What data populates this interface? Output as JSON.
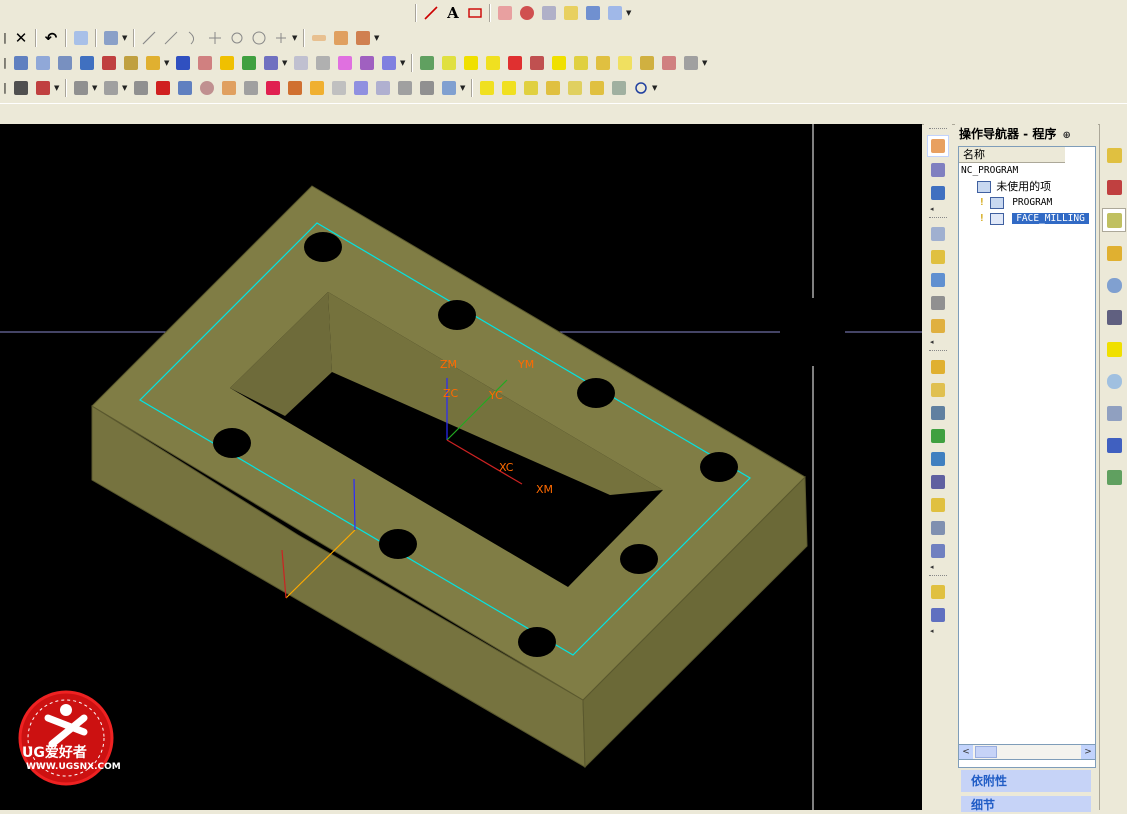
{
  "toolbar": {
    "text_tool_glyph": "A",
    "undo_glyph": "↶",
    "delete_glyph": "✕",
    "row0": [
      "line-icon",
      "text-icon",
      "rectangle-icon",
      "face-icon",
      "curve-icon",
      "transform-icon",
      "analysis-icon",
      "feature-icon",
      "view-icon"
    ],
    "row1": [
      "undo-icon",
      "copy-icon",
      "properties-icon",
      "line-icon",
      "arc-icon",
      "spline-icon",
      "point-icon",
      "circle-icon",
      "plus-icon",
      "sketch-icon",
      "dimension-icon",
      "edit-icon"
    ],
    "row2": [
      "cube-icon",
      "grid-icon",
      "frame-icon",
      "box-icon",
      "assembly-icon",
      "block-icon",
      "layer-icon",
      "component-icon",
      "warning-icon",
      "colour-icon",
      "text-style-icon",
      "mirror-icon",
      "surface-icon",
      "blend-icon",
      "table-icon",
      "bolt-icon",
      "pattern-icon",
      "program-icon",
      "tool-icon",
      "power-icon",
      "abc-icon",
      "verify-icon",
      "toolpath-icon",
      "name-icon",
      "machine-icon",
      "post-icon",
      "shop-doc-icon",
      "report-icon",
      "simulate-icon",
      "gear-icon"
    ],
    "row3": [
      "print-icon",
      "print-preview-icon",
      "shade-icon",
      "wireframe-icon",
      "book-icon",
      "solid-icon",
      "camera-icon",
      "sphere-icon",
      "lighting-icon",
      "clip-icon",
      "render-icon",
      "material-icon",
      "paint-icon",
      "delete-view-icon",
      "erase-icon",
      "layer-view-icon",
      "surface-view-icon",
      "layout-icon",
      "num-3-icon",
      "num-4-icon",
      "chart-icon",
      "clipboard-icon",
      "note-icon",
      "operations-icon",
      "loop-icon"
    ]
  },
  "viewport": {
    "labels": {
      "zm": "ZM",
      "ym": "YM",
      "zc": "ZC",
      "yc": "YC",
      "xc": "XC",
      "xm": "XM"
    },
    "colors": {
      "background": "#000000",
      "part_top": "#807d45",
      "part_side": "#6b6937",
      "part_front": "#76733f",
      "toolpath": "#00e5e5",
      "label": "#ff6a00"
    }
  },
  "left_strip": {
    "icons": [
      "highlight-icon",
      "geometry-view-icon",
      "program-view-icon",
      "method-view-icon",
      "create-program-icon",
      "create-tool-icon",
      "create-geometry-icon",
      "create-method-icon",
      "create-operation-icon",
      "generate-icon",
      "replay-icon",
      "list-icon",
      "verify-icon",
      "post-process-icon",
      "output-icon",
      "shop-docs-icon",
      "cut-icon",
      "copy-tool-icon",
      "paste-icon",
      "edit-object-icon",
      "transform-icon"
    ]
  },
  "navigator": {
    "title": "操作导航器 - 程序",
    "pin_glyph": "⊕",
    "column_header": "名称",
    "root": "NC_PROGRAM",
    "items": [
      {
        "label": "未使用的项",
        "indent": 1
      },
      {
        "label": "PROGRAM",
        "indent": 2
      },
      {
        "label": "FACE_MILLING",
        "indent": 2,
        "selected": true
      }
    ],
    "scroll_left": "<",
    "scroll_right": ">",
    "dependencies_label": "依附性",
    "details_label": "细节"
  },
  "resource_bar": {
    "icons": [
      "operation-navigator-icon",
      "assembly-navigator-icon",
      "part-navigator-icon",
      "reuse-library-icon",
      "web-browser-icon",
      "training-icon",
      "help-icon",
      "history-icon",
      "system-materials-icon",
      "process-icon",
      "roles-icon"
    ]
  },
  "watermark": {
    "brand": "UG爱好者",
    "url": "WWW.UGSNX.COM"
  }
}
